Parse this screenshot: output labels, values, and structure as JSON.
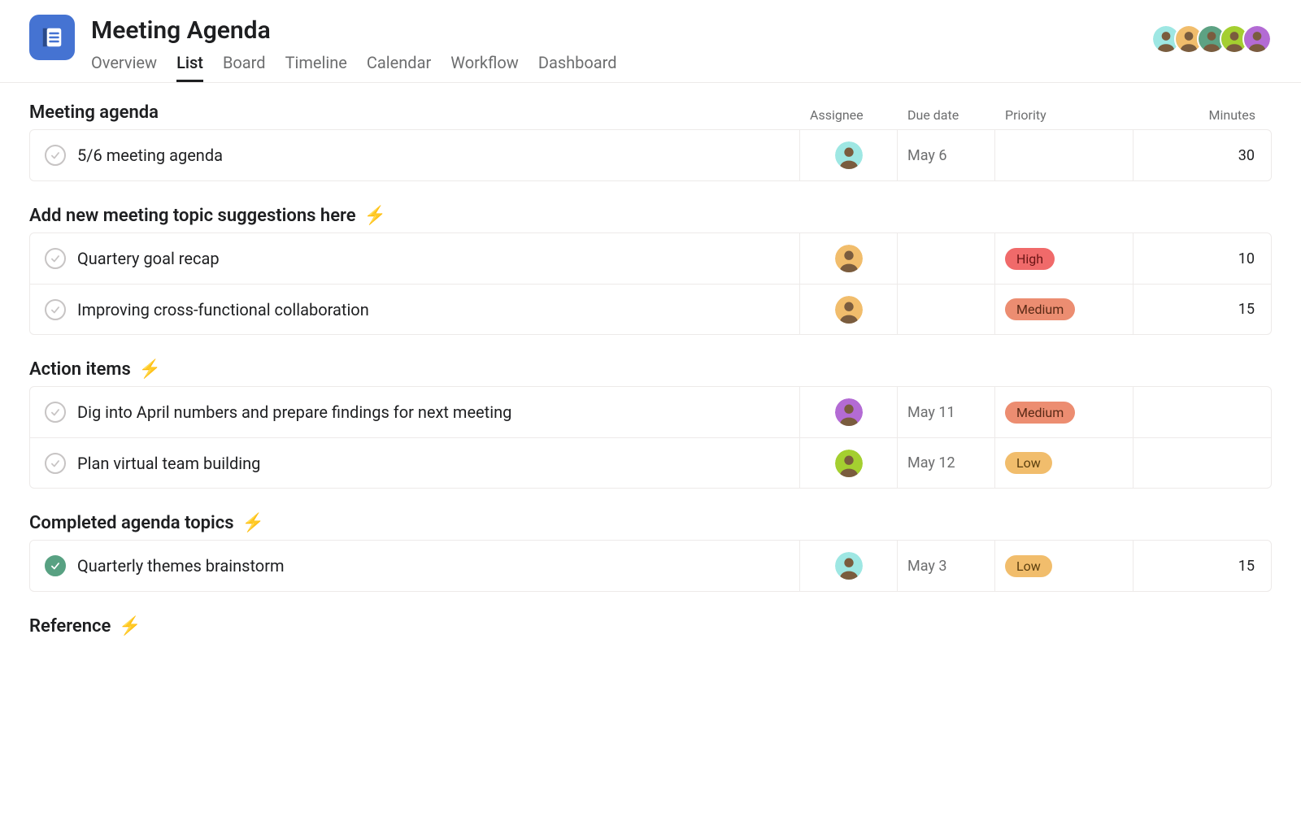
{
  "project": {
    "title": "Meeting Agenda",
    "tabs": [
      "Overview",
      "List",
      "Board",
      "Timeline",
      "Calendar",
      "Workflow",
      "Dashboard"
    ],
    "active_tab": "List",
    "collaborators": [
      {
        "bg": "#9ee7e3"
      },
      {
        "bg": "#f1bd6c"
      },
      {
        "bg": "#5da283"
      },
      {
        "bg": "#a4cf30"
      },
      {
        "bg": "#b36bd4"
      }
    ]
  },
  "columns": {
    "assignee": "Assignee",
    "due_date": "Due date",
    "priority": "Priority",
    "minutes": "Minutes"
  },
  "priority_styles": {
    "High": "pill-high",
    "Medium": "pill-medium",
    "Low": "pill-low"
  },
  "sections": [
    {
      "title": "Meeting agenda",
      "bolt": false,
      "show_headers": true,
      "tasks": [
        {
          "name": "5/6 meeting agenda",
          "done": false,
          "assignee_bg": "#9ee7e3",
          "due": "May 6",
          "priority": "",
          "minutes": "30"
        }
      ]
    },
    {
      "title": "Add new meeting topic suggestions here",
      "bolt": true,
      "show_headers": false,
      "tasks": [
        {
          "name": "Quartery goal recap",
          "done": false,
          "assignee_bg": "#f1bd6c",
          "due": "",
          "priority": "High",
          "minutes": "10"
        },
        {
          "name": "Improving cross-functional collaboration",
          "done": false,
          "assignee_bg": "#f1bd6c",
          "due": "",
          "priority": "Medium",
          "minutes": "15"
        }
      ]
    },
    {
      "title": "Action items",
      "bolt": true,
      "show_headers": false,
      "tasks": [
        {
          "name": "Dig into April numbers and prepare findings for next meeting",
          "done": false,
          "assignee_bg": "#b36bd4",
          "due": "May 11",
          "priority": "Medium",
          "minutes": ""
        },
        {
          "name": "Plan virtual team building",
          "done": false,
          "assignee_bg": "#a4cf30",
          "due": "May 12",
          "priority": "Low",
          "minutes": ""
        }
      ]
    },
    {
      "title": "Completed agenda topics",
      "bolt": true,
      "show_headers": false,
      "tasks": [
        {
          "name": "Quarterly themes brainstorm",
          "done": true,
          "assignee_bg": "#9ee7e3",
          "due": "May 3",
          "priority": "Low",
          "minutes": "15"
        }
      ]
    },
    {
      "title": "Reference",
      "bolt": true,
      "show_headers": false,
      "tasks": []
    }
  ]
}
